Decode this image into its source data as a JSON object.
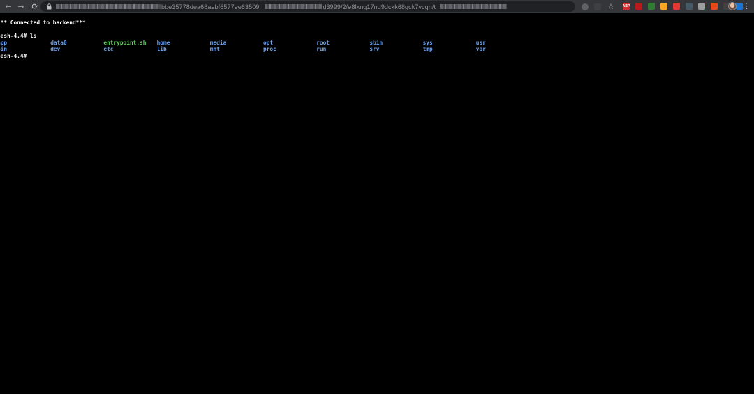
{
  "browser": {
    "back_glyph": "←",
    "forward_glyph": "→",
    "reload_glyph": "⟳",
    "url_visible_1": "bbe35778dea66aebf6577ee63509",
    "url_visible_2": "d3999/2/e8lxnq17nd9dckk68gck7vcqn/t",
    "star_glyph": "☆",
    "menu_glyph": "⋮",
    "extensions": [
      {
        "label": "ABP",
        "color": "#d32f2f"
      },
      {
        "label": "",
        "color": "#b71c1c"
      },
      {
        "label": "",
        "color": "#2e7d32"
      },
      {
        "label": "",
        "color": "#f9a825"
      },
      {
        "label": "",
        "color": "#e53935"
      },
      {
        "label": "",
        "color": "#455a64"
      },
      {
        "label": "",
        "color": "#9e9e9e"
      },
      {
        "label": "",
        "color": "#e64a19"
      },
      {
        "label": "",
        "color": "#424242"
      },
      {
        "label": "",
        "color": "#1976d2"
      }
    ]
  },
  "terminal": {
    "connected_message": "*** Connected to backend***",
    "prompt_1": "bash-4.4# ls",
    "prompt_2": "bash-4.4#",
    "ls_rows": [
      [
        "app",
        "data0",
        "entrypoint.sh",
        "home",
        "media",
        "opt",
        "root",
        "sbin",
        "sys",
        "usr"
      ],
      [
        "bin",
        "dev",
        "etc",
        "lib",
        "mnt",
        "proc",
        "run",
        "srv",
        "tmp",
        "var"
      ]
    ],
    "executable_entries": [
      "entrypoint.sh"
    ],
    "colors": {
      "directory": "#6fa3f0",
      "executable": "#5fd35f",
      "text": "#ffffff",
      "background": "#000000"
    }
  }
}
